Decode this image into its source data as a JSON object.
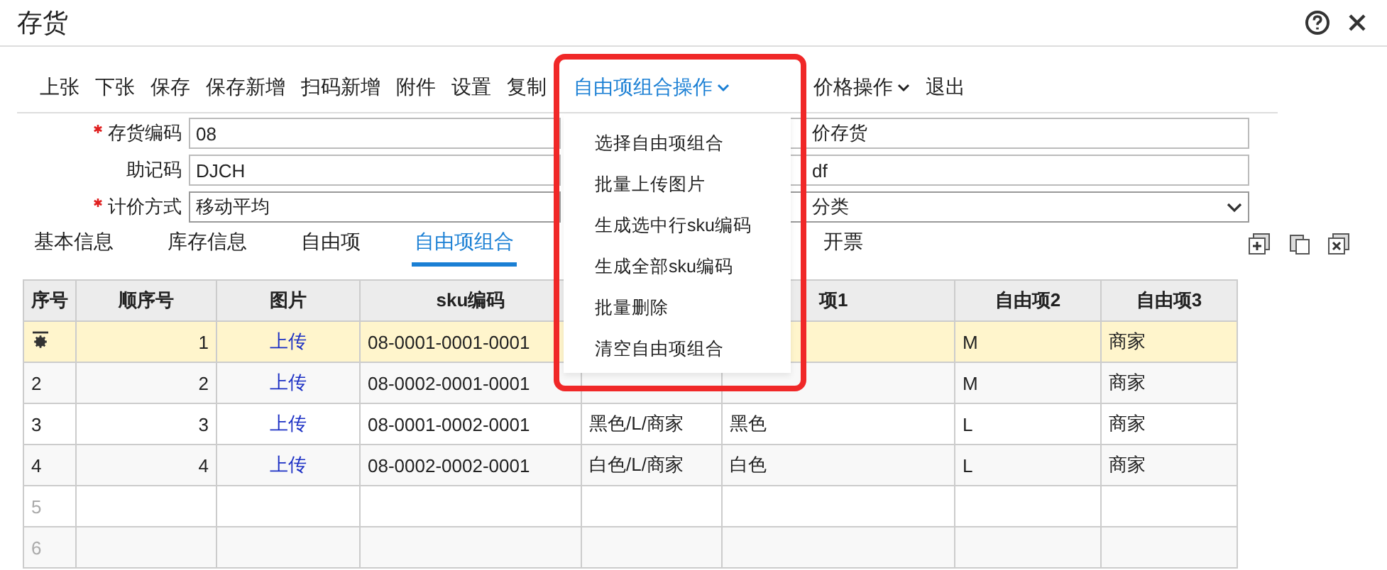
{
  "window": {
    "title": "存货"
  },
  "toolbar": [
    {
      "label": "上张",
      "kind": "button"
    },
    {
      "label": "下张",
      "kind": "button"
    },
    {
      "label": "保存",
      "kind": "button"
    },
    {
      "label": "保存新增",
      "kind": "button"
    },
    {
      "label": "扫码新增",
      "kind": "button"
    },
    {
      "label": "附件",
      "kind": "button"
    },
    {
      "label": "设置",
      "kind": "button"
    },
    {
      "label": "复制",
      "kind": "button"
    },
    {
      "label": "自由项组合操作",
      "kind": "dropdown",
      "expanded": true,
      "menu": [
        "选择自由项组合",
        "批量上传图片",
        "生成选中行sku编码",
        "生成全部sku编码",
        "批量删除",
        "清空自由项组合"
      ]
    },
    {
      "label": "价格操作",
      "kind": "dropdown",
      "expanded": false
    },
    {
      "label": "退出",
      "kind": "button"
    }
  ],
  "form": [
    {
      "label": "存货编码",
      "required": true,
      "value": "08",
      "kind": "text",
      "right": {
        "value": "价存货",
        "kind": "text"
      }
    },
    {
      "label": "助记码",
      "required": false,
      "value": "DJCH",
      "kind": "text",
      "right": {
        "value": "df",
        "kind": "text"
      }
    },
    {
      "label": "计价方式",
      "required": true,
      "value": "移动平均",
      "kind": "select",
      "right": {
        "value": "分类",
        "kind": "select"
      }
    }
  ],
  "tabs": [
    {
      "label": "基本信息",
      "selected": false
    },
    {
      "label": "库存信息",
      "selected": false
    },
    {
      "label": "自由项",
      "selected": false
    },
    {
      "label": "自由项组合",
      "selected": true
    },
    {
      "label": "开票",
      "selected": false
    }
  ],
  "table": {
    "columns": [
      {
        "label": "序号"
      },
      {
        "label": "顺序号"
      },
      {
        "label": "图片"
      },
      {
        "label": "sku编码"
      },
      {},
      {
        "label": "项1"
      },
      {
        "label": "自由项2"
      },
      {
        "label": "自由项3"
      }
    ],
    "rows": [
      {
        "selected": true,
        "disabled": false,
        "order": "1",
        "image": "上传",
        "sku": "08-0001-0001-0001",
        "item2": "M",
        "item3": "商家"
      },
      {
        "selected": false,
        "disabled": false,
        "index": "2",
        "order": "2",
        "image": "上传",
        "sku": "08-0002-0001-0001",
        "item2": "M",
        "item3": "商家"
      },
      {
        "selected": false,
        "disabled": false,
        "index": "3",
        "order": "3",
        "image": "上传",
        "sku": "08-0001-0002-0001",
        "combo": "黑色/L/商家",
        "item1": "黑色",
        "item2": "L",
        "item3": "商家"
      },
      {
        "selected": false,
        "disabled": false,
        "index": "4",
        "order": "4",
        "image": "上传",
        "sku": "08-0002-0002-0001",
        "combo": "白色/L/商家",
        "item1": "白色",
        "item2": "L",
        "item3": "商家"
      },
      {
        "selected": false,
        "disabled": true,
        "index": "5"
      },
      {
        "selected": false,
        "disabled": true,
        "index": "6"
      }
    ]
  }
}
